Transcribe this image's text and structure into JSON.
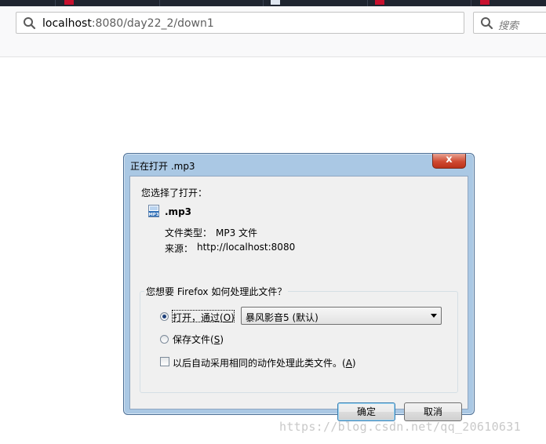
{
  "browser": {
    "url_host": "localhost",
    "url_rest": ":8080/day22_2/down1",
    "search_placeholder": "搜索"
  },
  "dialog": {
    "title": "正在打开 .mp3",
    "close_symbol": "x",
    "chose_label": "您选择了打开：",
    "file_name": ".mp3",
    "file_icon_text": "MP3",
    "type_label": "文件类型：",
    "type_value": "MP3 文件",
    "source_label": "来源：",
    "source_value": "http://localhost:8080",
    "question": "您想要 Firefox 如何处理此文件？",
    "open_with_label": "打开，通过(",
    "open_with_key": "O",
    "open_with_close": ")",
    "open_with_selected": true,
    "app_selected": "暴风影音5 (默认)",
    "save_label": "保存文件(",
    "save_key": "S",
    "save_close": ")",
    "remember_label": "以后自动采用相同的动作处理此类文件。(",
    "remember_key": "A",
    "remember_close": ")",
    "remember_checked": false,
    "ok_label": "确定",
    "cancel_label": "取消"
  },
  "watermark": "https://blog.csdn.net/qq_20610631",
  "colors": {
    "tabstrip": "#1f2530",
    "dialog_frame": "#aac8e4",
    "close_button": "#cf4a32",
    "dialog_body": "#f0f0f0"
  }
}
